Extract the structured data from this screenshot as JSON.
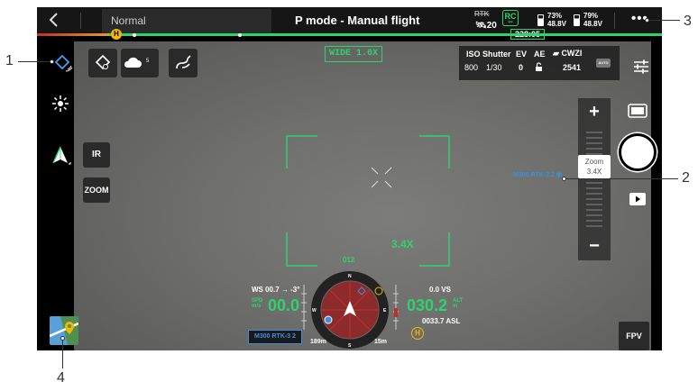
{
  "topbar": {
    "back_icon": "chevron-left-icon",
    "mode_value": "Normal",
    "flight_title": "P mode - Manual flight",
    "rtk_label": "RTK",
    "satellites": "20",
    "rc_badge": "RC",
    "timer": "228:05",
    "battery1": {
      "percent": "73%",
      "voltage": "48.8V"
    },
    "battery2": {
      "percent": "79%",
      "voltage": "48.8V"
    },
    "more_label": "•••"
  },
  "progress": {
    "home_marker": "H"
  },
  "left": {
    "ir_label": "IR",
    "zoom_label": "ZOOM",
    "weather_sub": "5"
  },
  "camera": {
    "lens_label": "WIDE 1.0X",
    "zoom_factor": "3.4X",
    "params": {
      "iso_label": "ISO",
      "iso_value": "800",
      "shutter_label": "Shutter",
      "shutter_value": "1/30",
      "ev_label": "EV",
      "ev_value": "0",
      "ae_label": "AE",
      "storage_label": "CWZI",
      "storage_value": "2541",
      "auto_badge": "AUTO"
    }
  },
  "right": {
    "zoom_plus": "+",
    "zoom_minus": "−",
    "zoom_tooltip_title": "Zoom",
    "zoom_tooltip_value": "3.4X",
    "fpv_label": "FPV"
  },
  "peer_label": "M300 RTK-3 2",
  "hud": {
    "heading": "012",
    "ws": "WS 00.7 → -3°",
    "spd_label": "SPD",
    "spd_unit": "m/s",
    "spd_value": "00.0",
    "vs": "0.0 VS",
    "alt_value": "030.2",
    "alt_label": "ALT",
    "alt_unit": "m",
    "asl": "0033.7 ASL",
    "peer_box": "M300 RTK-3 2",
    "dist1": "189m",
    "dist2": "15m",
    "home": "H"
  },
  "callouts": [
    "1",
    "2",
    "3",
    "4"
  ],
  "colors": {
    "accent": "#2fd36d",
    "home": "#f5b800",
    "peer": "#3a8fe0",
    "alert": "#c0302a"
  }
}
